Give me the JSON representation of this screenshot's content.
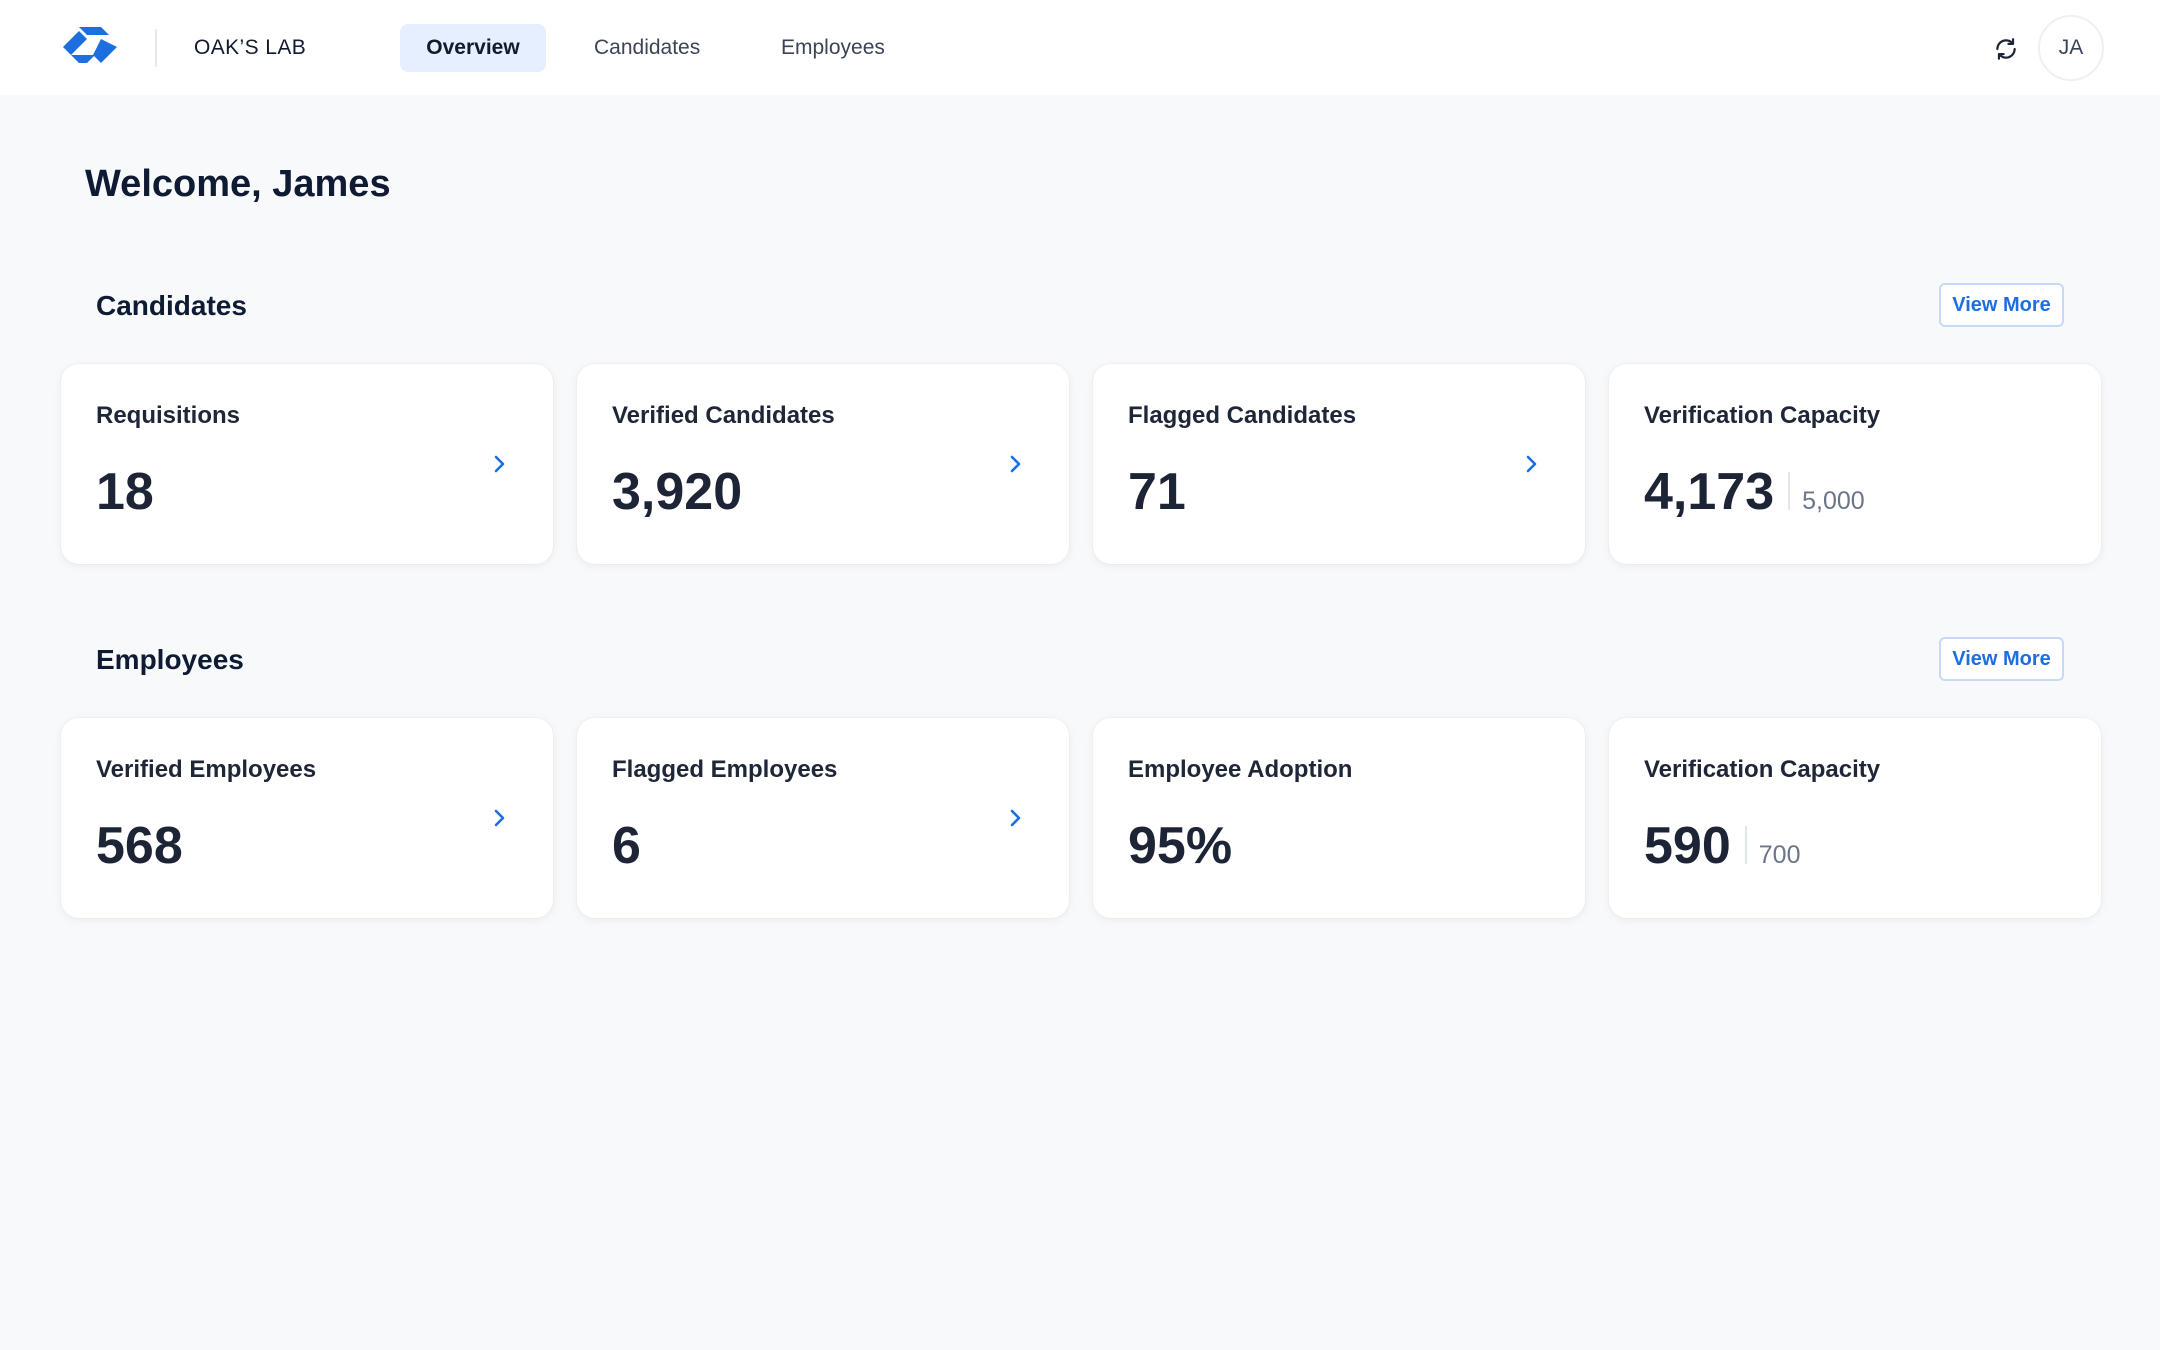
{
  "header": {
    "org_name": "OAK’S LAB",
    "tabs": [
      {
        "label": "Overview",
        "active": true
      },
      {
        "label": "Candidates",
        "active": false
      },
      {
        "label": "Employees",
        "active": false
      }
    ],
    "refresh_icon": "refresh-icon",
    "avatar_initials": "JA"
  },
  "welcome": "Welcome, James",
  "candidates": {
    "title": "Candidates",
    "view_more": "View More",
    "cards": [
      {
        "label": "Requisitions",
        "value": "18"
      },
      {
        "label": "Verified Candidates",
        "value": "3,920"
      },
      {
        "label": "Flagged Candidates",
        "value": "71"
      },
      {
        "label": "Verification Capacity",
        "value": "4,173",
        "total": "5,000"
      }
    ]
  },
  "employees": {
    "title": "Employees",
    "view_more": "View More",
    "cards": [
      {
        "label": "Verified Employees",
        "value": "568"
      },
      {
        "label": "Flagged Employees",
        "value": "6"
      },
      {
        "label": "Employee Adoption",
        "value": "95%"
      },
      {
        "label": "Verification Capacity",
        "value": "590",
        "total": "700"
      }
    ]
  },
  "colors": {
    "accent": "#1d6fe0",
    "background": "#f8f9fb",
    "active_tab_bg": "#e6efff",
    "text_dark": "#111a2e"
  }
}
